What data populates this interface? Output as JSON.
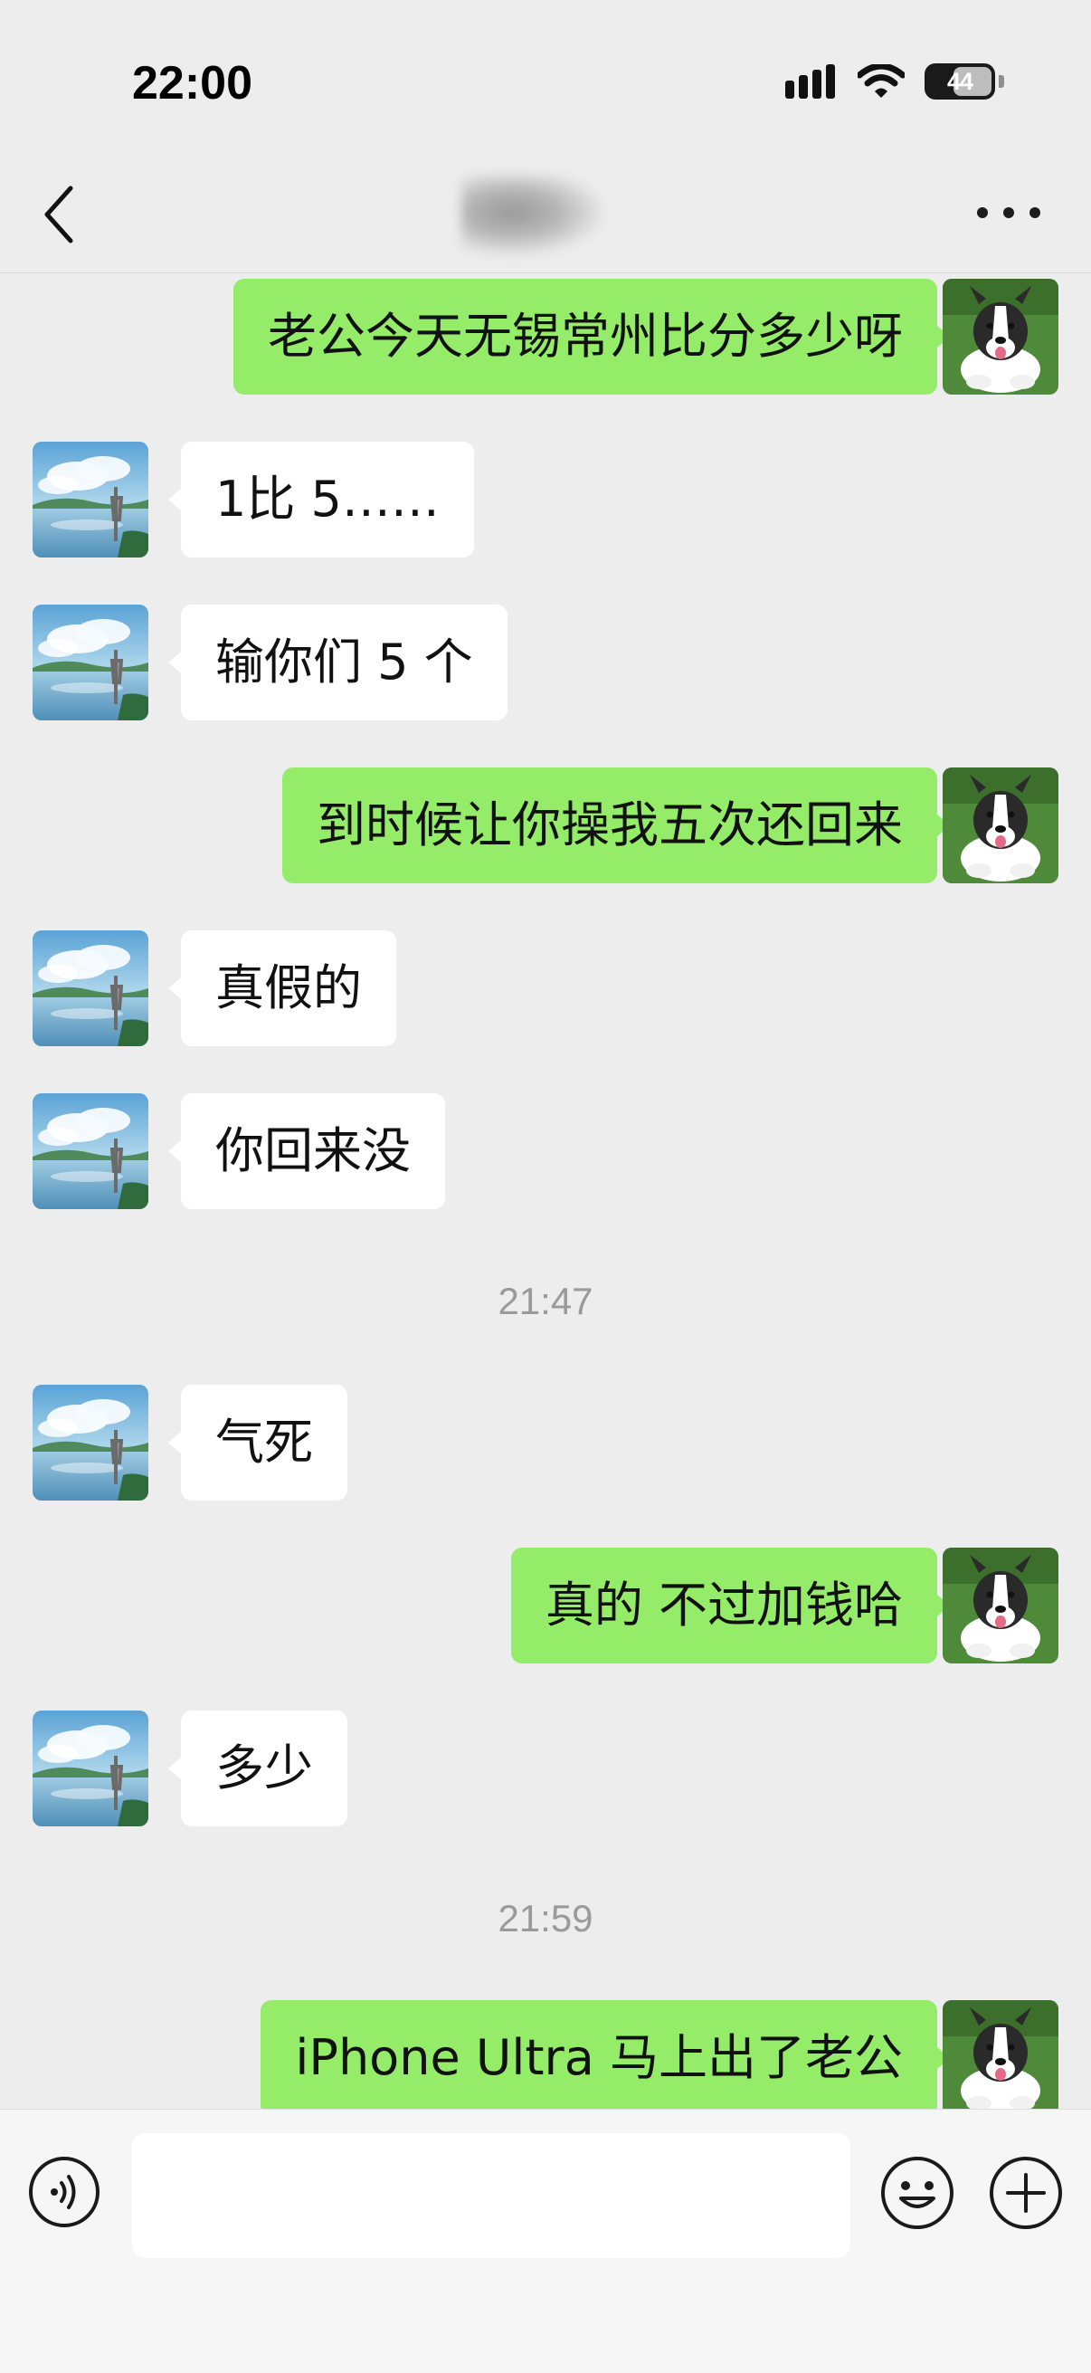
{
  "status_bar": {
    "time": "22:00",
    "battery_level": "44",
    "icons": [
      "cellular-signal-icon",
      "wifi-icon",
      "battery-icon"
    ]
  },
  "nav": {
    "icons": [
      "back-chevron-icon",
      "more-dots-icon"
    ]
  },
  "messages": [
    {
      "side": "out",
      "text": "老公今天无锡常州比分多少呀"
    },
    {
      "side": "in",
      "text": "1比 5……"
    },
    {
      "side": "in",
      "text": "输你们 5 个"
    },
    {
      "side": "out",
      "text": "到时候让你操我五次还回来"
    },
    {
      "side": "in",
      "text": "真假的"
    },
    {
      "side": "in",
      "text": "你回来没"
    },
    {
      "side": "in",
      "text": "气死"
    },
    {
      "side": "out",
      "text": "真的 不过加钱哈"
    },
    {
      "side": "in",
      "text": "多少"
    },
    {
      "side": "out",
      "text": "iPhone Ultra 马上出了老公"
    }
  ],
  "timestamps": [
    "21:47",
    "21:59"
  ],
  "input_bar": {
    "value": "",
    "icons": [
      "voice-icon",
      "emoji-icon",
      "plus-icon"
    ]
  },
  "colors": {
    "background": "#ededed",
    "outgoing_bubble": "#95ec69",
    "incoming_bubble": "#ffffff",
    "timestamp_text": "#9a9a9a"
  }
}
